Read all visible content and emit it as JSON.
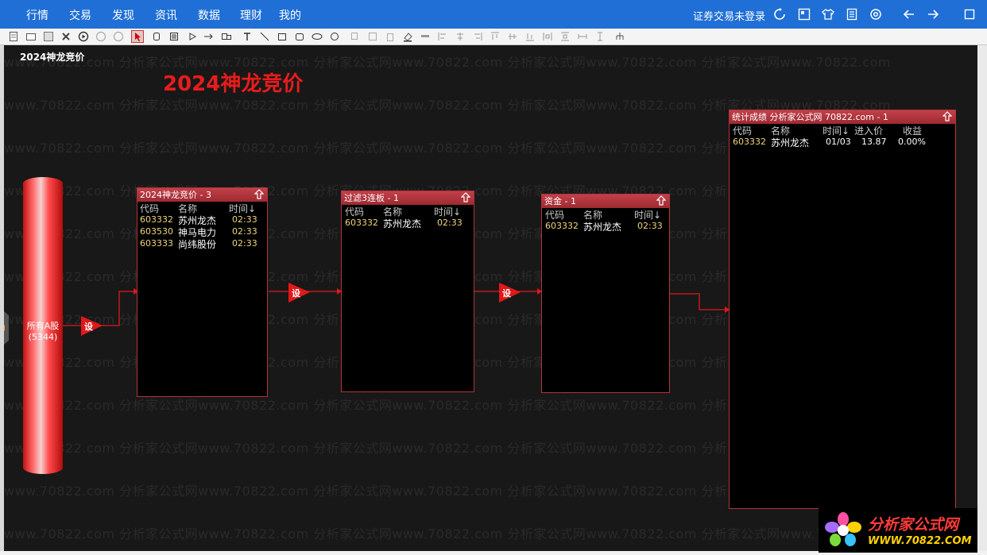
{
  "menu": {
    "items": [
      "行情",
      "交易",
      "发现",
      "资讯",
      "数据",
      "理财",
      "我的"
    ],
    "login_status": "证券交易未登录"
  },
  "icons": {
    "top_right": [
      "refresh-icon",
      "grid-icon",
      "shirt-icon",
      "document-icon",
      "settings-icon",
      "back-arrow-icon",
      "forward-arrow-icon",
      "window-icon"
    ]
  },
  "canvas": {
    "page_title": "2024神龙竞价",
    "big_title": "2024神龙竞价",
    "watermark": "www.70822.com 分析家公式网www.70822.com 分析家公式网www.70822.com 分析家公式网www.70822.com 分析家公式网www.70822.com"
  },
  "source": {
    "label": "所有A股",
    "count": "(5344)"
  },
  "connectors": {
    "set_label": "设"
  },
  "panels": [
    {
      "title": "2024神龙竞价 - 3",
      "columns": [
        "代码",
        "名称",
        "时间↓"
      ],
      "rows": [
        {
          "code": "603332",
          "name": "苏州龙杰",
          "time": "02:33"
        },
        {
          "code": "603530",
          "name": "神马电力",
          "time": "02:33"
        },
        {
          "code": "603333",
          "name": "尚纬股份",
          "time": "02:33"
        }
      ]
    },
    {
      "title": "过滤3连板 - 1",
      "columns": [
        "代码",
        "名称",
        "时间↓"
      ],
      "rows": [
        {
          "code": "603332",
          "name": "苏州龙杰",
          "time": "02:33"
        }
      ]
    },
    {
      "title": "资金 - 1",
      "columns": [
        "代码",
        "名称",
        "时间↓"
      ],
      "rows": [
        {
          "code": "603332",
          "name": "苏州龙杰",
          "time": "02:33"
        }
      ]
    }
  ],
  "stats_panel": {
    "title": "统计成绩 分析家公式网 70822.com - 1",
    "columns": [
      "代码",
      "名称",
      "时间↓",
      "进入价",
      "收益"
    ],
    "rows": [
      {
        "code": "603332",
        "name": "苏州龙杰",
        "date": "01/03",
        "entry_price": "13.87",
        "gain": "0.00%"
      }
    ]
  },
  "logo": {
    "title": "分析家公式网",
    "url": "WWW.70822.COM"
  },
  "colors": {
    "menu_bg": "#1f6fd6",
    "canvas_bg": "#181818",
    "panel_border": "#b3323a",
    "accent_red": "#e81c1c",
    "code_text": "#f2d47a"
  }
}
